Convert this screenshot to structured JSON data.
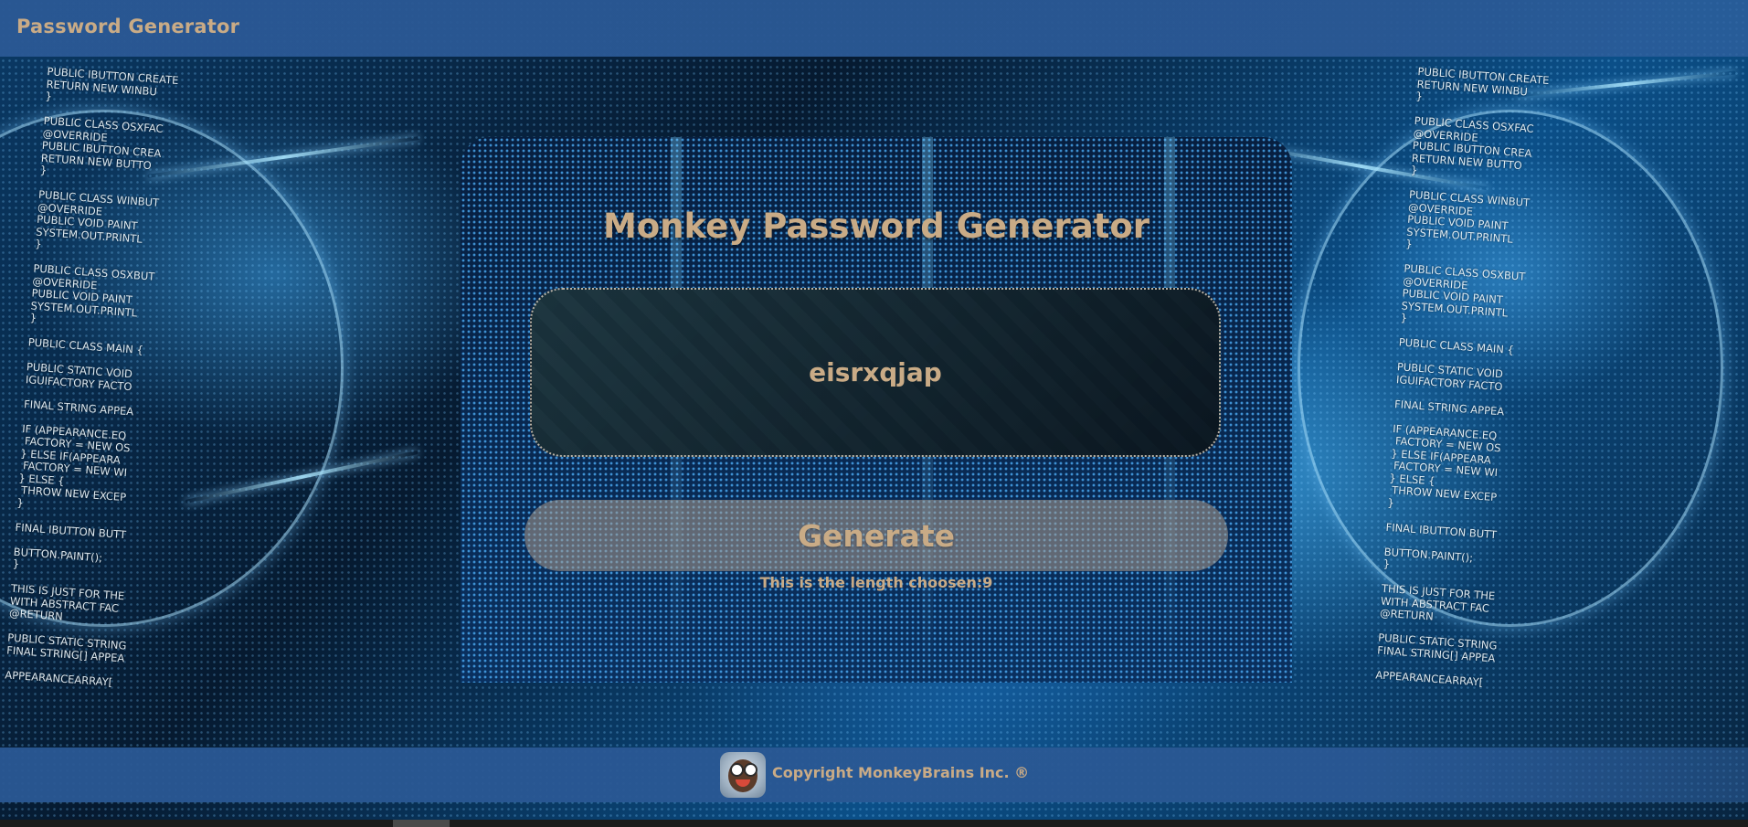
{
  "header": {
    "title": "Password Generator"
  },
  "card": {
    "title": "Monkey Password Generator",
    "password_value": "eisrxqjap",
    "generate_label": "Generate",
    "length_text": "This is the length choosen:9"
  },
  "footer": {
    "copyright": "Copyright MonkeyBrains Inc. ®"
  },
  "background_code": [
    "PUBLIC IBUTTON CREATE",
    "RETURN NEW WINBU",
    "}",
    "",
    "PUBLIC CLASS OSXFAC",
    "@OVERRIDE",
    "PUBLIC IBUTTON CREA",
    "RETURN NEW BUTTO",
    "}",
    "",
    "PUBLIC CLASS WINBUT",
    "@OVERRIDE",
    "PUBLIC VOID PAINT",
    "SYSTEM.OUT.PRINTL",
    "}",
    "",
    "PUBLIC CLASS OSXBUT",
    "@OVERRIDE",
    "PUBLIC VOID PAINT",
    "SYSTEM.OUT.PRINTL",
    "}",
    "",
    "PUBLIC CLASS MAIN {",
    "",
    "PUBLIC STATIC VOID",
    "IGUIFACTORY FACTO",
    "",
    "FINAL STRING APPEA",
    "",
    "IF (APPEARANCE.EQ",
    " FACTORY = NEW OS",
    "} ELSE IF(APPEARA",
    " FACTORY = NEW WI",
    "} ELSE {",
    " THROW NEW EXCEP",
    "}",
    "",
    "FINAL IBUTTON BUTT",
    "",
    "BUTTON.PAINT();",
    "}",
    "",
    "THIS IS JUST FOR THE",
    "WITH ABSTRACT FAC",
    "@RETURN",
    "",
    "PUBLIC STATIC STRING",
    "FINAL STRING[] APPEA",
    "",
    "APPEARANCEARRAY["
  ],
  "colors": {
    "accent_text": "#c9ab86",
    "bar_blue": "#2a5894",
    "button_bg": "#aa9b8c"
  }
}
